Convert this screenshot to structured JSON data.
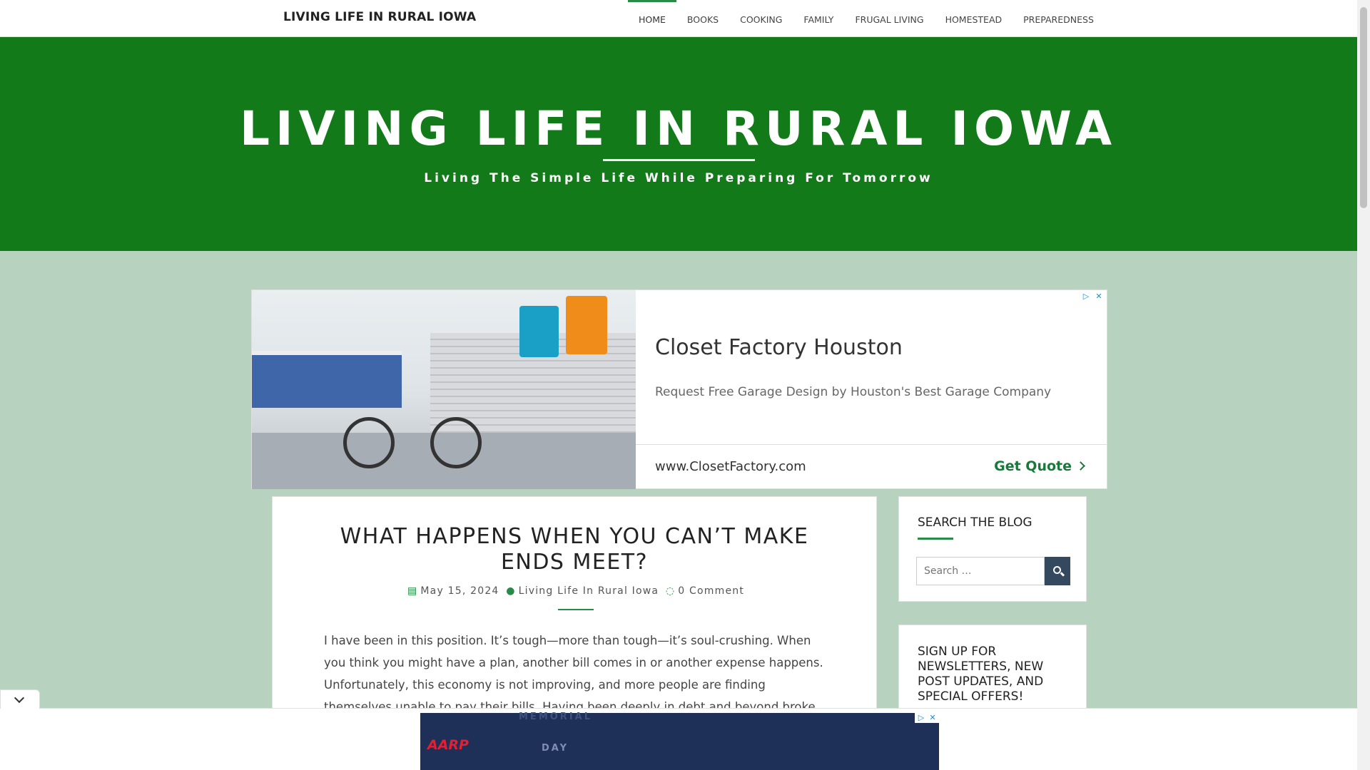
{
  "nav": {
    "brand": "LIVING LIFE IN RURAL IOWA",
    "items": [
      {
        "label": "HOME",
        "active": true
      },
      {
        "label": "BOOKS"
      },
      {
        "label": "COOKING"
      },
      {
        "label": "FAMILY"
      },
      {
        "label": "FRUGAL LIVING"
      },
      {
        "label": "HOMESTEAD"
      },
      {
        "label": "PREPAREDNESS"
      }
    ]
  },
  "hero": {
    "title": "LIVING LIFE IN RURAL IOWA",
    "tagline": "Living The Simple Life While Preparing For Tomorrow"
  },
  "ad": {
    "title": "Closet Factory Houston",
    "description": "Request Free Garage Design by Houston's Best Garage Company",
    "url": "www.ClosetFactory.com",
    "cta": "Get Quote",
    "adchoices_icon": "play-triangle-icon",
    "close_icon": "close-icon"
  },
  "post": {
    "title": "WHAT HAPPENS WHEN YOU CAN’T MAKE ENDS MEET?",
    "date": "May 15, 2024",
    "author": "Living Life In Rural Iowa",
    "comments": "0 Comment",
    "body": "I have been in this position. It’s tough—more than tough—it’s soul-crushing. When you think you might have a plan, another bill comes in or another expense happens.  Unfortunately, this economy is not improving, and more people are finding themselves unable to pay their bills. Having been deeply in debt and beyond broke, I have some tips and advice to navigate this"
  },
  "sidebar": {
    "search_title": "SEARCH THE BLOG",
    "search_placeholder": "Search …",
    "signup_title": "SIGN UP FOR NEWSLETTERS, NEW POST UPDATES, AND SPECIAL OFFERS!"
  },
  "sticky_ad": {
    "brand": "AARP",
    "line1": "MEMORIAL",
    "line2": "DAY"
  },
  "colors": {
    "accent": "#2a8a47",
    "hero_bg": "#137a1a",
    "page_bg": "#b8d2c0"
  }
}
